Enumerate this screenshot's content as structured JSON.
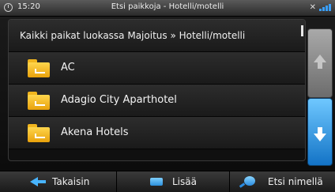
{
  "status_bar": {
    "time": "15:20",
    "title": "Etsi paikkoja - Hotelli/motelli",
    "icons": [
      "clock-icon",
      "gps-icon",
      "signal-icon"
    ]
  },
  "list": {
    "header": "Kaikki paikat luokassa Majoitus » Hotelli/motelli",
    "items": [
      {
        "label": "AC",
        "icon": "hotel-folder-icon"
      },
      {
        "label": "Adagio City Aparthotel",
        "icon": "hotel-folder-icon"
      },
      {
        "label": "Akena Hotels",
        "icon": "hotel-folder-icon"
      }
    ]
  },
  "scroll": {
    "up_icon": "arrow-up-icon",
    "down_icon": "arrow-down-icon",
    "accent_color": "#1f8ff0"
  },
  "bottom_bar": {
    "back_label": "Takaisin",
    "more_label": "Lisää",
    "search_label": "Etsi nimellä"
  },
  "colors": {
    "folder": "#f5c22a",
    "accent": "#3aa0ff"
  }
}
